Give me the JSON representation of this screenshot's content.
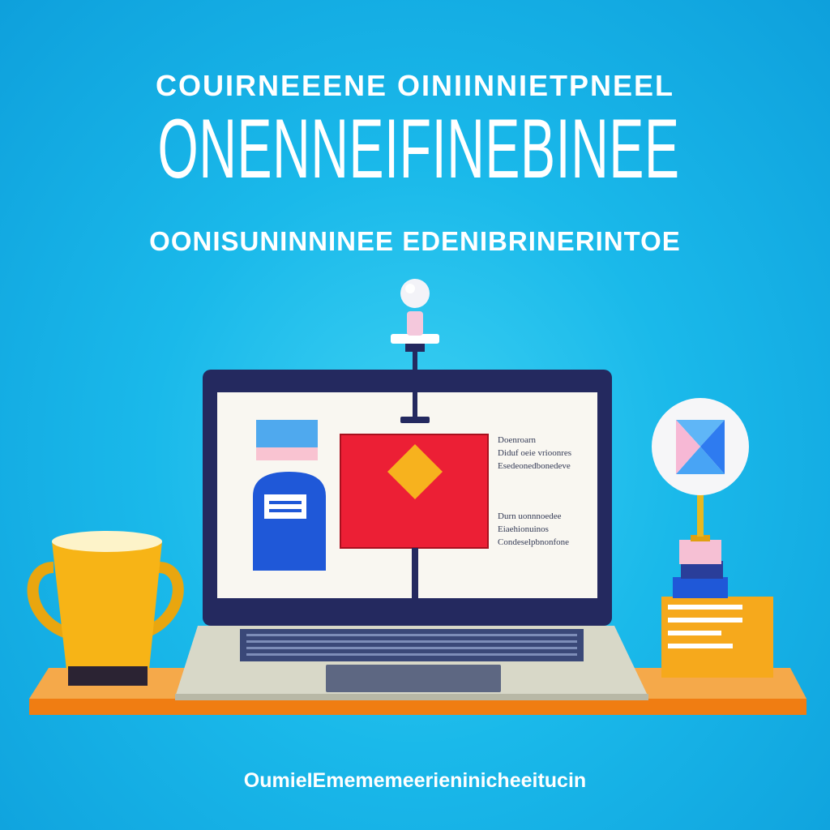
{
  "header": {
    "top_line": "COUIRNEEENE OINIINNIETPNEEL",
    "main_title": "ONENNEIFINEBINEE",
    "subtitle": "OONISUNINNINEE  EDENIBRINERINTOE"
  },
  "screen": {
    "text_block_1": [
      "Doenroarn",
      "Diduf oeie vrioonres",
      "Esedeonedbonedeve"
    ],
    "text_block_2": [
      "Durn uonnnoedee",
      "Eiaehionuinos",
      "Condeselpbnonfone"
    ]
  },
  "footer": {
    "text": "OumieIEmememeerieninicheeitucin"
  },
  "colors": {
    "background": "#1ab9ea",
    "desk": "#f59a2a",
    "mug": "#f7b416",
    "laptop_frame": "#24295f",
    "screen": "#f9f7f1",
    "red_panel": "#ec1f35",
    "diamond": "#f7b21e",
    "blue_card": "#1f58d8"
  },
  "icons": [
    "lamp-icon",
    "mug-icon",
    "laptop-icon",
    "pie-chart-icon",
    "mailbox-icon",
    "diamond-icon"
  ]
}
